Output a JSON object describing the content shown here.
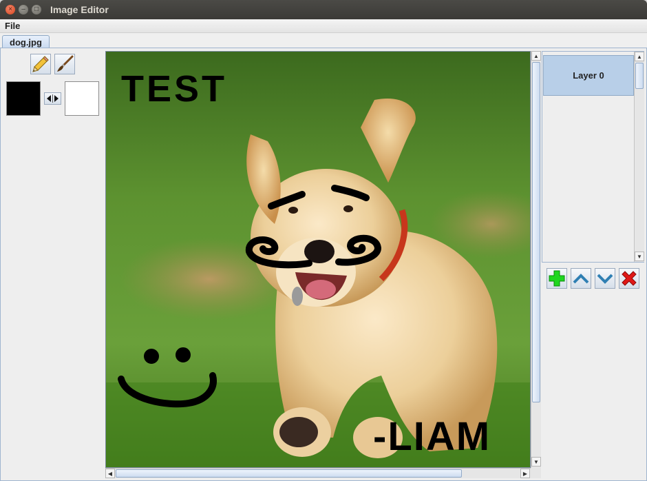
{
  "window": {
    "title": "Image Editor",
    "controls": {
      "close": "×",
      "minimize": "–",
      "maximize": "□"
    }
  },
  "menu": {
    "file": "File"
  },
  "tabs": [
    {
      "label": "dog.jpg",
      "active": true
    }
  ],
  "tools": {
    "pencil": "pencil-icon",
    "brush": "brush-icon",
    "foreground_color": "#000000",
    "background_color": "#ffffff",
    "swap": "swap-colors-icon"
  },
  "canvas": {
    "image": "photo of a golden retriever puppy running on grass",
    "annotations": {
      "top_left": "TEST",
      "bottom_right": "-LIAM"
    }
  },
  "layers": {
    "items": [
      {
        "label": "Layer 0",
        "selected": true
      }
    ],
    "buttons": {
      "add": "plus-icon",
      "up": "chevron-up-icon",
      "down": "chevron-down-icon",
      "delete": "x-icon"
    }
  },
  "colors": {
    "accent": "#b8cfe8",
    "add_green": "#1fd61f",
    "delete_red": "#e01818",
    "arrow_blue": "#2f7fb3"
  }
}
